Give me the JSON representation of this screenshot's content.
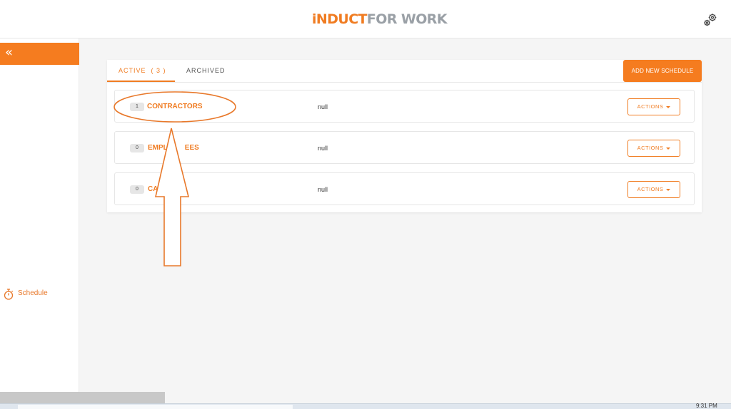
{
  "header": {
    "logo_part1": "iNDUCT",
    "logo_part2": "FOR WORK"
  },
  "sidebar": {
    "items": [
      {
        "label": "Schedule"
      }
    ]
  },
  "tabs": [
    {
      "label": "ACTIVE  ( 3 )",
      "active": true
    },
    {
      "label": "ARCHIVED",
      "active": false
    }
  ],
  "toolbar": {
    "add_label": "ADD NEW SCHEDULE"
  },
  "schedules": [
    {
      "count": "1",
      "name": "CONTRACTORS",
      "description": "null",
      "actions_label": "ACTIONS"
    },
    {
      "count": "0",
      "name": "EMPL",
      "name_tail": "EES",
      "description": "null",
      "actions_label": "ACTIONS"
    },
    {
      "count": "0",
      "name": "CA",
      "description": "null",
      "actions_label": "ACTIONS"
    }
  ],
  "taskbar": {
    "clock": "9:31 PM"
  },
  "colors": {
    "accent": "#f57c1f",
    "logo_grey": "#9aa0a6",
    "annotation": "#e8782a"
  }
}
